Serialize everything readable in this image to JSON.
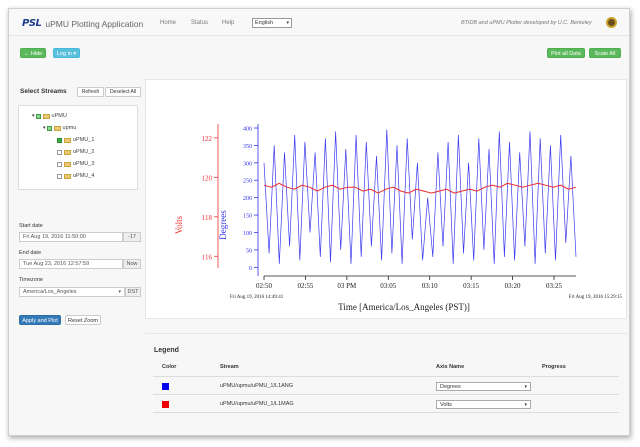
{
  "navbar": {
    "logo": "PSL",
    "title": "uPMU Plotting Application",
    "links": [
      "Home",
      "Status",
      "Help"
    ],
    "language": "English",
    "credit": "BTrDB and uPMU Plotter developed by U.C. Berkeley"
  },
  "toolbar": {
    "hide_label": "← Hide",
    "login_label": "Log in ▾",
    "plot_all_label": "Plot all Data",
    "scale_all_label": "Scale All"
  },
  "sidebar": {
    "select_streams_title": "Select Streams",
    "refresh_label": "Refresh",
    "deselect_all_label": "Deselect All",
    "tree": [
      "uPMU",
      "upmu",
      "uPMU_1",
      "uPMU_2",
      "uPMU_3",
      "uPMU_4"
    ],
    "start_date_label": "Start date",
    "start_date_value": "Fri Aug 19, 2016 11:50:00",
    "start_offset": "-17",
    "end_date_label": "End date",
    "end_date_value": "Tue Aug 23, 2016 12:57:59",
    "end_now": "Now",
    "timezone_label": "Timezone",
    "timezone_value": "America/Los_Angeles",
    "dst_label": "DST",
    "apply_plot_label": "Apply and Plot",
    "reset_zoom_label": "Reset Zoom"
  },
  "chart": {
    "left_axis_title": "Volts",
    "right_axis_title": "Degrees",
    "x_axis_title": "Time [America/Los_Angeles (PST)]",
    "start_caption": "Fri Aug 19, 2016 14:49:41",
    "end_caption": "Fri Aug 19, 2016 15:29:15"
  },
  "chart_data": {
    "type": "line",
    "x_ticks": [
      "02:50",
      "02:55",
      "03 PM",
      "03:05",
      "03:10",
      "03:15",
      "03:20",
      "03:25"
    ],
    "y_left": {
      "label": "Volts",
      "ticks": [
        122,
        120,
        118,
        116
      ],
      "range": [
        115,
        122.5
      ],
      "color": "#ee3333"
    },
    "y_right": {
      "label": "Degrees",
      "ticks": [
        400,
        350,
        300,
        250,
        200,
        150,
        100,
        50,
        0
      ],
      "range": [
        -25,
        400
      ],
      "color": "#3333ee"
    },
    "series": [
      {
        "name": "uPMU/upmu/uPMU_1/L1ANG",
        "axis": "right",
        "color": "#3a3af0",
        "values": [
          300,
          40,
          350,
          10,
          330,
          60,
          380,
          20,
          360,
          100,
          330,
          30,
          370,
          15,
          390,
          50,
          340,
          10,
          380,
          30,
          360,
          60,
          320,
          20,
          395,
          40,
          350,
          10,
          370,
          80,
          300,
          20,
          200,
          30,
          330,
          60,
          360,
          10,
          380,
          40,
          300,
          20,
          370,
          50,
          340,
          10,
          390,
          30,
          360,
          20,
          330,
          60,
          390,
          10,
          370,
          40,
          350,
          20,
          380,
          70,
          320,
          30
        ]
      },
      {
        "name": "uPMU/upmu/uPMU_1/L1MAG",
        "axis": "left",
        "color": "#ee2b2b",
        "values": [
          119.6,
          119.5,
          119.7,
          119.5,
          119.4,
          119.6,
          119.5,
          119.3,
          119.5,
          119.6,
          119.4,
          119.5,
          119.5,
          119.3,
          119.4,
          119.2,
          119.4,
          119.5,
          119.3,
          119.2,
          119.4,
          119.3,
          119.2,
          119.3,
          119.4,
          119.2,
          119.3,
          119.4,
          119.3,
          119.5,
          119.6,
          119.5,
          119.7,
          119.6,
          119.5,
          119.6,
          119.7,
          119.6,
          119.5,
          119.6,
          119.4,
          119.5
        ]
      }
    ]
  },
  "legend": {
    "title": "Legend",
    "headers": [
      "Color",
      "Stream",
      "Axis Name",
      "Progress"
    ],
    "rows": [
      {
        "color": "#0000ee",
        "stream": "uPMU/upmu/uPMU_1/L1ANG",
        "axis": "Degrees"
      },
      {
        "color": "#ee0000",
        "stream": "uPMU/upmu/uPMU_1/L1MAG",
        "axis": "Volts"
      }
    ]
  }
}
